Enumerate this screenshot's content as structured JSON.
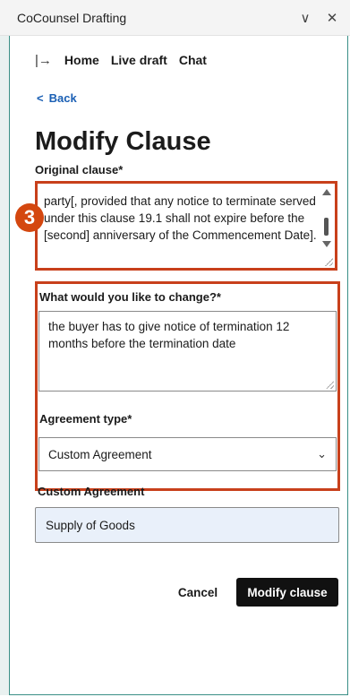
{
  "window": {
    "title": "CoCounsel Drafting",
    "chevron_glyph": "∨",
    "close_glyph": "✕"
  },
  "nav": {
    "expand_glyph": "|→",
    "items": [
      "Home",
      "Live draft",
      "Chat"
    ]
  },
  "back": {
    "chevron": "<",
    "label": "Back"
  },
  "page": {
    "title": "Modify Clause"
  },
  "original_clause": {
    "label": "Original clause*",
    "text": "party[, provided that any notice to terminate served under this clause 19.1 shall not expire before the [second] anniversary of the Commencement Date]."
  },
  "step_badge": "3",
  "change": {
    "label": "What would you like to change?*",
    "value": "the buyer has to give notice of termination 12 months before the termination date"
  },
  "agreement_type": {
    "label": "Agreement type*",
    "selected": "Custom Agreement"
  },
  "custom_agreement": {
    "label": "Custom Agreement",
    "value": "Supply of Goods"
  },
  "actions": {
    "cancel_label": "Cancel",
    "modify_label": "Modify clause"
  },
  "colors": {
    "accent_border": "#3a8f86",
    "highlight": "#c8401b",
    "badge": "#d4470f",
    "link": "#1a5fb4",
    "primary_button": "#111111"
  }
}
